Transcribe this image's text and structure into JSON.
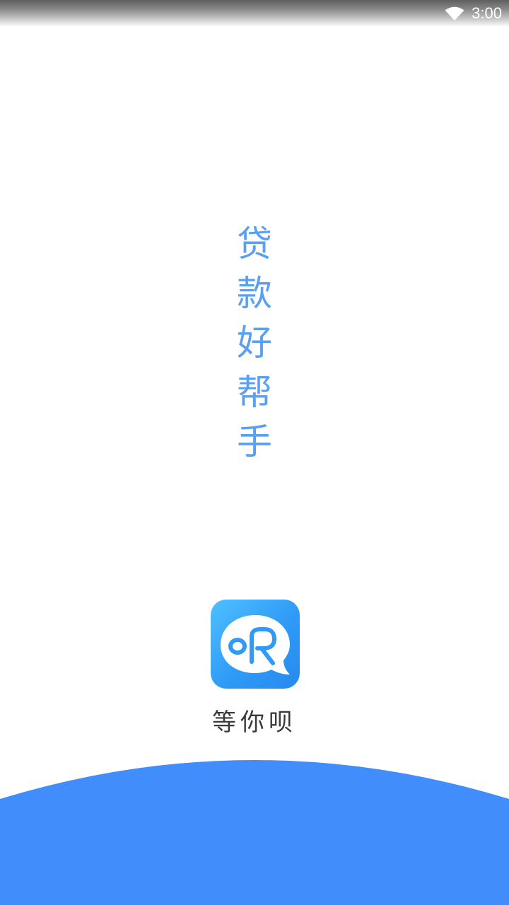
{
  "status_bar": {
    "time": "3:00",
    "wifi_icon": "wifi-icon"
  },
  "slogan": {
    "chars": [
      "贷",
      "款",
      "好",
      "帮",
      "手"
    ]
  },
  "app": {
    "icon": "app-logo-icon",
    "name": "等你呗"
  },
  "colors": {
    "slogan": "#5aa0f2",
    "brand_blue": "#418dfb",
    "icon_blue": "#2f9bf7",
    "app_name": "#3a3a3a"
  }
}
